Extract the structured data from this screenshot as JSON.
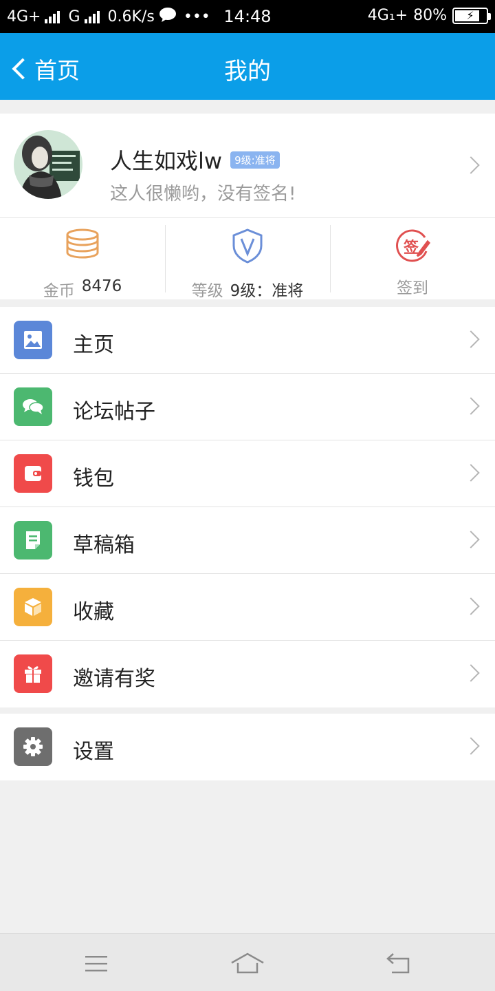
{
  "status_bar": {
    "left_network": "4G+",
    "second_network": "G",
    "speed": "0.6K/s",
    "more": "•••",
    "time": "14:48",
    "right_network": "4G₁+",
    "battery": "80%",
    "battery_level": 0.8
  },
  "nav": {
    "back_label": "首页",
    "title": "我的"
  },
  "profile": {
    "name": "人生如戏lw",
    "level_badge": "9级:准将",
    "signature": "这人很懒哟，没有签名!"
  },
  "stats": [
    {
      "icon": "coins-icon",
      "label": "金币",
      "value": "8476",
      "color": "#e8a25c"
    },
    {
      "icon": "shield-v-icon",
      "label": "等级",
      "value": "9级：准将",
      "color": "#6b8fd8"
    },
    {
      "icon": "sign-in-icon",
      "label": "签到",
      "value": "",
      "color": "#e05050",
      "stamp": "签"
    }
  ],
  "menu": [
    {
      "label": "主页",
      "icon": "image-icon",
      "color": "#5b87d8"
    },
    {
      "label": "论坛帖子",
      "icon": "chat-bubbles-icon",
      "color": "#4cb870"
    },
    {
      "label": "钱包",
      "icon": "wallet-icon",
      "color": "#f04a4a"
    },
    {
      "label": "草稿箱",
      "icon": "draft-note-icon",
      "color": "#4cb870"
    },
    {
      "label": "收藏",
      "icon": "box-icon",
      "color": "#f5b03c"
    },
    {
      "label": "邀请有奖",
      "icon": "gift-icon",
      "color": "#f04a4a"
    }
  ],
  "settings": {
    "label": "设置",
    "icon": "gear-icon",
    "color": "#6e6e6e"
  }
}
